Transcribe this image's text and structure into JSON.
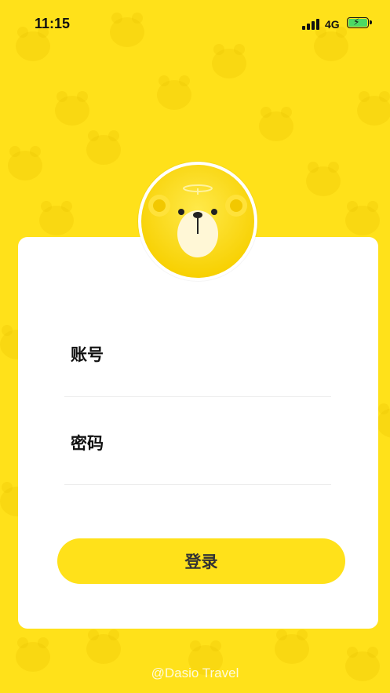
{
  "status_bar": {
    "time": "11:15",
    "network": "4G",
    "signal_icon": "signal-bars-icon",
    "battery_icon": "battery-charging-icon"
  },
  "avatar": {
    "icon": "bear-mascot-icon"
  },
  "form": {
    "account_label": "账号",
    "account_value": "",
    "password_label": "密码",
    "password_value": ""
  },
  "login_button": {
    "label": "登录"
  },
  "footer": {
    "credit": "@Dasio Travel"
  },
  "colors": {
    "background": "#FFE11A",
    "button": "#FFE11A",
    "card": "#FFFFFF",
    "battery": "#4CD964"
  }
}
